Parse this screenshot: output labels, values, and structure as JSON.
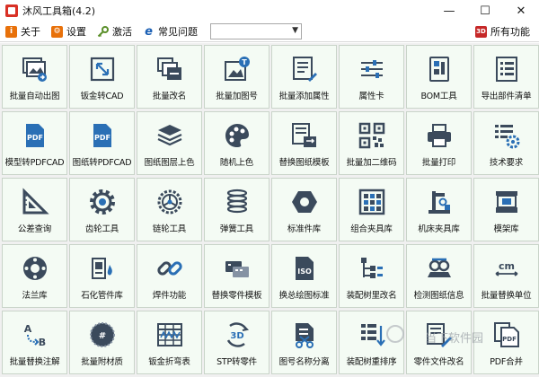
{
  "window": {
    "title": "沐风工具箱(4.2)",
    "controls": {
      "minimize": "—",
      "maximize": "☐",
      "close": "✕"
    }
  },
  "toolbar": {
    "items": [
      {
        "label": "关于",
        "icon": "info-icon",
        "color": "#e8710a"
      },
      {
        "label": "设置",
        "icon": "settings-icon",
        "color": "#e8710a"
      },
      {
        "label": "激活",
        "icon": "key-icon",
        "color": "#5a8f29"
      },
      {
        "label": "常见问题",
        "icon": "ie-help-icon",
        "color": "#1a5fb4"
      }
    ],
    "combo_value": "",
    "right_item": {
      "label": "所有功能",
      "icon": "all-functions-icon",
      "color": "#c62828"
    }
  },
  "tools": [
    {
      "label": "批量自动出图",
      "icon": "auto-drawing-icon"
    },
    {
      "label": "钣金转CAD",
      "icon": "sheetmetal-cad-icon"
    },
    {
      "label": "批量改名",
      "icon": "batch-rename-icon"
    },
    {
      "label": "批量加图号",
      "icon": "add-drawing-number-icon"
    },
    {
      "label": "批量添加属性",
      "icon": "add-property-icon"
    },
    {
      "label": "属性卡",
      "icon": "property-card-icon"
    },
    {
      "label": "BOM工具",
      "icon": "bom-icon"
    },
    {
      "label": "导出部件清单",
      "icon": "export-list-icon"
    },
    {
      "label": "模型转PDFCAD",
      "icon": "model-pdf-icon"
    },
    {
      "label": "图纸转PDFCAD",
      "icon": "drawing-pdf-icon"
    },
    {
      "label": "图纸图层上色",
      "icon": "layers-icon"
    },
    {
      "label": "随机上色",
      "icon": "palette-icon"
    },
    {
      "label": "替换图纸模板",
      "icon": "replace-template-icon"
    },
    {
      "label": "批量加二维码",
      "icon": "qr-code-icon"
    },
    {
      "label": "批量打印",
      "icon": "printer-icon"
    },
    {
      "label": "技术要求",
      "icon": "tech-requirement-icon"
    },
    {
      "label": "公差查询",
      "icon": "tolerance-icon"
    },
    {
      "label": "齿轮工具",
      "icon": "gear-icon"
    },
    {
      "label": "链轮工具",
      "icon": "sprocket-icon"
    },
    {
      "label": "弹簧工具",
      "icon": "spring-icon"
    },
    {
      "label": "标准件库",
      "icon": "hex-nut-icon"
    },
    {
      "label": "组合夹具库",
      "icon": "fixture-grid-icon"
    },
    {
      "label": "机床夹具库",
      "icon": "machine-fixture-icon"
    },
    {
      "label": "模架库",
      "icon": "mold-base-icon"
    },
    {
      "label": "法兰库",
      "icon": "flange-icon"
    },
    {
      "label": "石化管件库",
      "icon": "pipe-fitting-icon"
    },
    {
      "label": "焊件功能",
      "icon": "weld-chain-icon"
    },
    {
      "label": "替换零件模板",
      "icon": "replace-part-icon"
    },
    {
      "label": "换总绘图标准",
      "icon": "iso-standard-icon"
    },
    {
      "label": "装配树里改名",
      "icon": "assembly-tree-rename-icon"
    },
    {
      "label": "检测图纸信息",
      "icon": "inspect-drawing-icon"
    },
    {
      "label": "批量替换单位",
      "icon": "unit-cm-icon"
    },
    {
      "label": "批量替换注解",
      "icon": "replace-annotation-icon"
    },
    {
      "label": "批量附材质",
      "icon": "material-icon"
    },
    {
      "label": "钣金折弯表",
      "icon": "bend-table-icon"
    },
    {
      "label": "STP转零件",
      "icon": "stp-3d-icon"
    },
    {
      "label": "图号名称分离",
      "icon": "split-name-icon"
    },
    {
      "label": "装配树重排序",
      "icon": "reorder-icon"
    },
    {
      "label": "零件文件改名",
      "icon": "file-rename-icon"
    },
    {
      "label": "PDF合并",
      "icon": "pdf-merge-icon"
    }
  ],
  "watermark": "当下软件园"
}
